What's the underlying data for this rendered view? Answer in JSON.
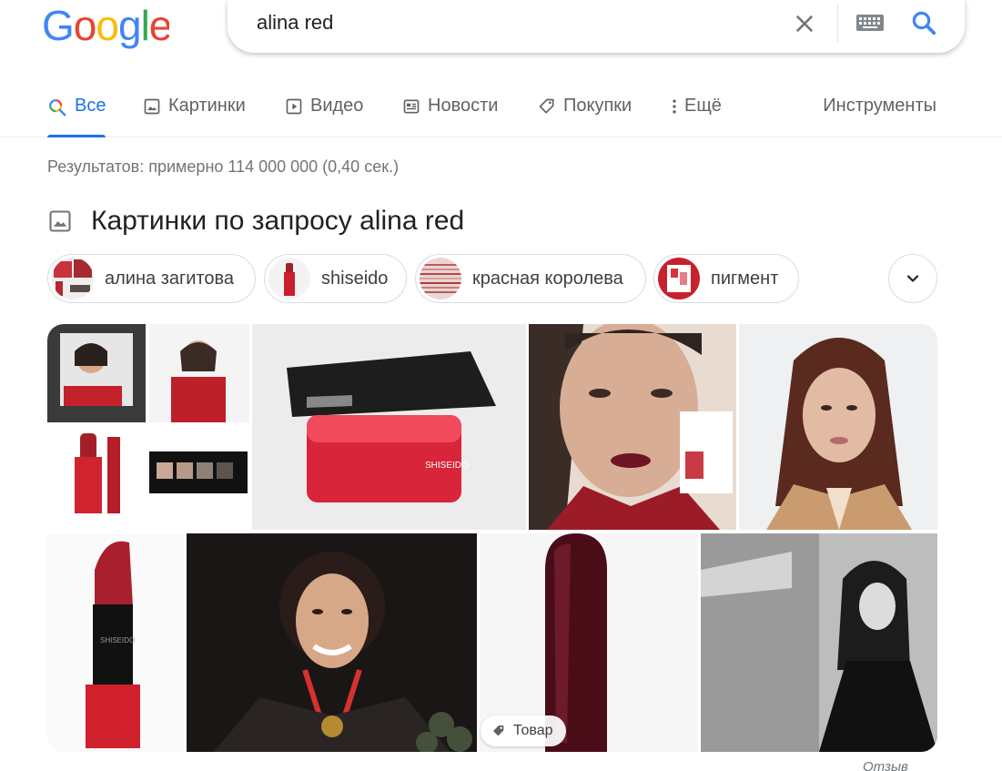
{
  "search": {
    "query": "alina red"
  },
  "tabs": [
    {
      "label": "Все",
      "icon": "search-icon"
    },
    {
      "label": "Картинки",
      "icon": "image-icon"
    },
    {
      "label": "Видео",
      "icon": "play-icon"
    },
    {
      "label": "Новости",
      "icon": "news-icon"
    },
    {
      "label": "Покупки",
      "icon": "tag-icon"
    },
    {
      "label": "Ещё",
      "icon": "more-vert-icon"
    }
  ],
  "tools_label": "Инструменты",
  "stats": "Результатов: примерно 114 000 000 (0,40 сек.)",
  "images_heading": "Картинки по запросу alina red",
  "chips": [
    {
      "label": "алина загитова"
    },
    {
      "label": "shiseido"
    },
    {
      "label": "красная королева"
    },
    {
      "label": "пигмент"
    }
  ],
  "product_badge": "Товар",
  "feedback": "Отзыв",
  "colors": {
    "accent": "#1a73e8",
    "google_blue": "#4285f4",
    "google_red": "#ea4335",
    "google_yellow": "#fbbc05",
    "google_green": "#34a853"
  }
}
